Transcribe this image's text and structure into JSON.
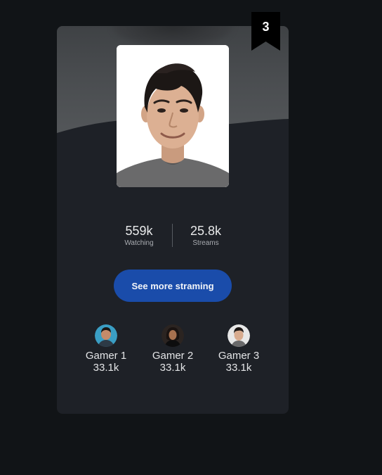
{
  "rank": {
    "number": "3",
    "ribbon_color": "#000000"
  },
  "profile": {
    "photo_icon": "streamer-portrait"
  },
  "stats": [
    {
      "value": "559k",
      "label": "Watching"
    },
    {
      "value": "25.8k",
      "label": "Streams"
    }
  ],
  "cta": {
    "label": "See more straming",
    "color": "#1a4caa"
  },
  "gamers": [
    {
      "name": "Gamer 1",
      "count": "33.1k",
      "avatar_icon": "gamer-avatar"
    },
    {
      "name": "Gamer 2",
      "count": "33.1k",
      "avatar_icon": "gamer-avatar"
    },
    {
      "name": "Gamer 3",
      "count": "33.1k",
      "avatar_icon": "gamer-avatar"
    }
  ],
  "colors": {
    "page_background": "#111417",
    "card_background": "#1e2127",
    "banner_gray": "#4a4d50"
  }
}
